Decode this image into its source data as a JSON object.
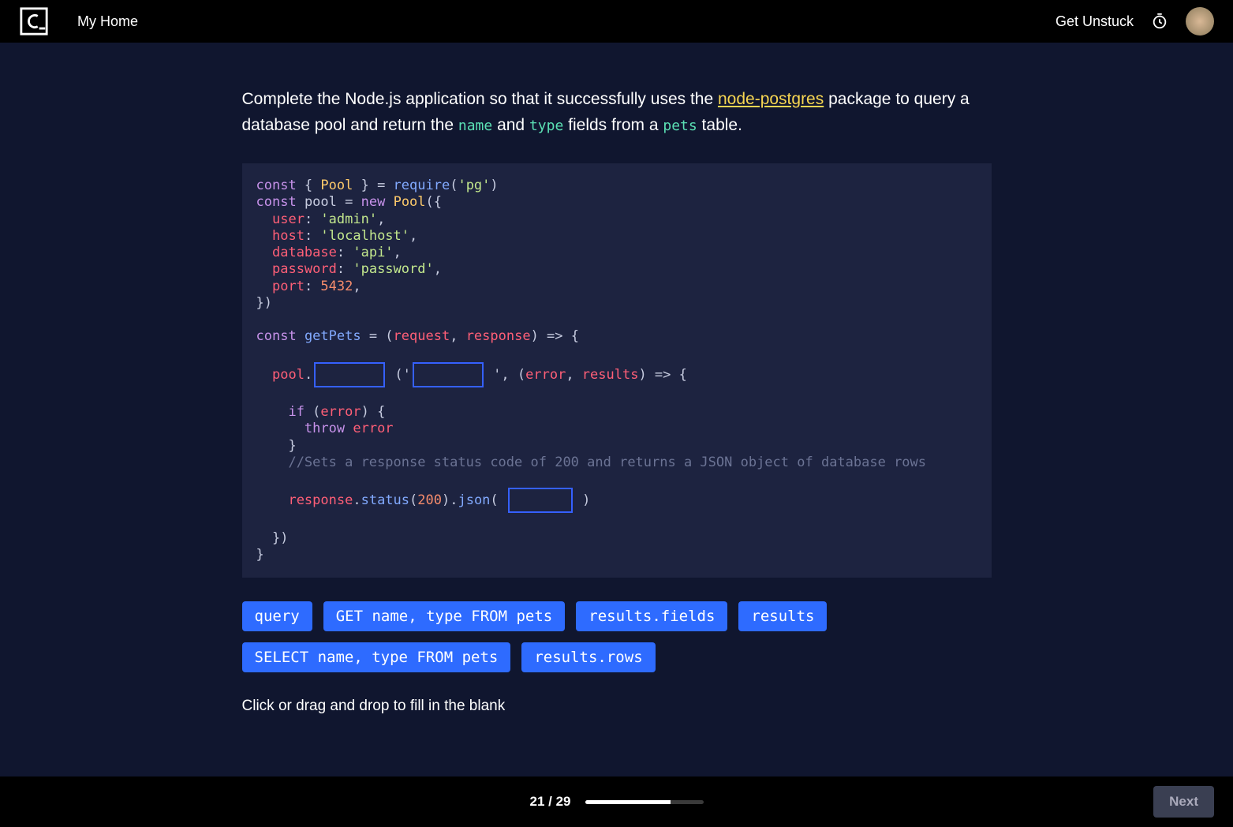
{
  "header": {
    "my_home": "My Home",
    "get_unstuck": "Get Unstuck"
  },
  "prompt": {
    "pre": "Complete the Node.js application so that it successfully uses the ",
    "link": "node-postgres",
    "mid1": " package to query a database pool and return the ",
    "code1": "name",
    "mid2": " and ",
    "code2": "type",
    "mid3": " fields from a ",
    "code3": "pets",
    "post": " table."
  },
  "code": {
    "l1": {
      "const": "const",
      "lb": " { ",
      "pool_class": "Pool",
      "rb": " } = ",
      "require": "require",
      "paren": "(",
      "pg": "'pg'",
      "close": ")"
    },
    "l2": {
      "const": "const",
      "sp": " ",
      "pool": "pool",
      "eq": " = ",
      "new": "new",
      "sp2": " ",
      "pool_class": "Pool",
      "open": "({"
    },
    "l3": {
      "indent": "  ",
      "key": "user",
      "colon": ": ",
      "val": "'admin'",
      "comma": ","
    },
    "l4": {
      "indent": "  ",
      "key": "host",
      "colon": ": ",
      "val": "'localhost'",
      "comma": ","
    },
    "l5": {
      "indent": "  ",
      "key": "database",
      "colon": ": ",
      "val": "'api'",
      "comma": ","
    },
    "l6": {
      "indent": "  ",
      "key": "password",
      "colon": ": ",
      "val": "'password'",
      "comma": ","
    },
    "l7": {
      "indent": "  ",
      "key": "port",
      "colon": ": ",
      "val": "5432",
      "comma": ","
    },
    "l8": {
      "close": "})"
    },
    "l10": {
      "const": "const",
      "sp": " ",
      "name": "getPets",
      "eq": " = (",
      "p1": "request",
      "c": ", ",
      "p2": "response",
      "arrow": ") => {"
    },
    "l12": {
      "indent": "  ",
      "pool": "pool",
      "dot": ".",
      "after_blank": " (",
      "quote1": "'",
      "quote2": " '",
      "open": ", (",
      "p1": "error",
      "c": ", ",
      "p2": "results",
      "close": ") => {"
    },
    "l14": {
      "indent": "    ",
      "if": "if",
      "open": " (",
      "err": "error",
      "close": ") {"
    },
    "l15": {
      "indent": "      ",
      "throw": "throw",
      "sp": " ",
      "err": "error"
    },
    "l16": {
      "indent": "    }",
      "close": ""
    },
    "l17": {
      "indent": "    ",
      "comment": "//Sets a response status code of 200 and returns a JSON object of database rows"
    },
    "l19": {
      "indent": "    ",
      "resp": "response",
      "dot": ".",
      "status": "status",
      "open": "(",
      "num": "200",
      "mid": ").",
      "json": "json",
      "open2": "(",
      "after": " )"
    },
    "l21": {
      "close": "  })"
    },
    "l22": {
      "close": "}"
    }
  },
  "options": [
    "query",
    "GET name, type FROM pets",
    "results.fields",
    "results",
    "SELECT name, type FROM pets",
    "results.rows"
  ],
  "hint": "Click or drag and drop to fill in the blank",
  "footer": {
    "progress_label": "21 / 29",
    "progress_pct": 72,
    "next": "Next"
  }
}
